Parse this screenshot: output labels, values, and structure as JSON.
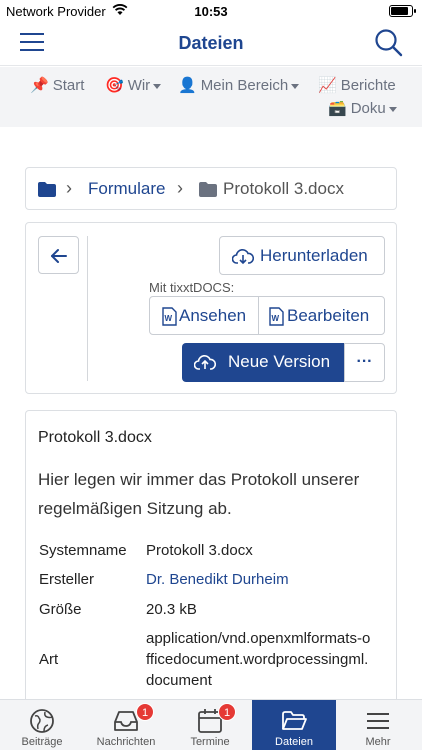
{
  "status": {
    "carrier": "Network Provider",
    "time": "10:53"
  },
  "header": {
    "title": "Dateien"
  },
  "nav": {
    "start": "Start",
    "wir": "Wir",
    "bereich": "Mein Bereich",
    "berichte": "Berichte",
    "doku": "Doku"
  },
  "breadcrumb": {
    "folder": "Formulare",
    "file": "Protokoll 3.docx"
  },
  "actions": {
    "download": "Herunterladen",
    "tixxt_label": "Mit tixxtDOCS:",
    "view": "Ansehen",
    "edit": "Bearbeiten",
    "new_version": "Neue Version",
    "more": "···"
  },
  "file": {
    "title": "Protokoll 3.docx",
    "description": "Hier legen wir immer das Protokoll unserer regelmäßigen Sitzung ab.",
    "props": {
      "systemname_label": "Systemname",
      "systemname": "Protokoll 3.docx",
      "creator_label": "Ersteller",
      "creator": "Dr. Benedikt Durheim",
      "size_label": "Größe",
      "size": "20.3 kB",
      "type_label": "Art",
      "type_line1": "application/vnd.openxmlformats-o",
      "type_line2": "fficedocument.wordprocessingml.",
      "type_line3": "document"
    }
  },
  "tabs": {
    "beitraege": "Beiträge",
    "nachrichten": "Nachrichten",
    "nachrichten_badge": "1",
    "termine": "Termine",
    "termine_badge": "1",
    "dateien": "Dateien",
    "mehr": "Mehr"
  },
  "colors": {
    "primary": "#1f4690",
    "badge": "#e53935"
  }
}
